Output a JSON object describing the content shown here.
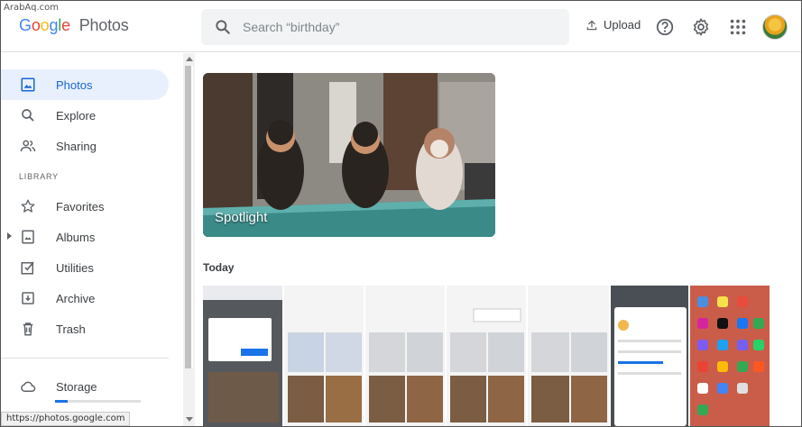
{
  "watermark": "ArabAq.com",
  "header": {
    "logo_google": "Google",
    "logo_photos": "Photos",
    "search_placeholder": "Search “birthday”",
    "upload_label": "Upload"
  },
  "sidebar": {
    "items": [
      {
        "label": "Photos",
        "icon": "photo-icon"
      },
      {
        "label": "Explore",
        "icon": "search-icon"
      },
      {
        "label": "Sharing",
        "icon": "people-icon"
      },
      {
        "label": "Favorites",
        "icon": "star-icon"
      },
      {
        "label": "Albums",
        "icon": "album-icon"
      },
      {
        "label": "Utilities",
        "icon": "utilities-icon"
      },
      {
        "label": "Archive",
        "icon": "archive-icon"
      },
      {
        "label": "Trash",
        "icon": "trash-icon"
      },
      {
        "label": "Storage",
        "icon": "cloud-icon"
      }
    ],
    "library_label": "LIBRARY",
    "storage_fill_fraction": 0.15
  },
  "main": {
    "spotlight_label": "Spotlight",
    "section_today": "Today"
  },
  "status_bar": {
    "url": "https://photos.google.com"
  },
  "colors": {
    "accent": "#1a73e8",
    "active_bg": "#e8f0fe"
  }
}
